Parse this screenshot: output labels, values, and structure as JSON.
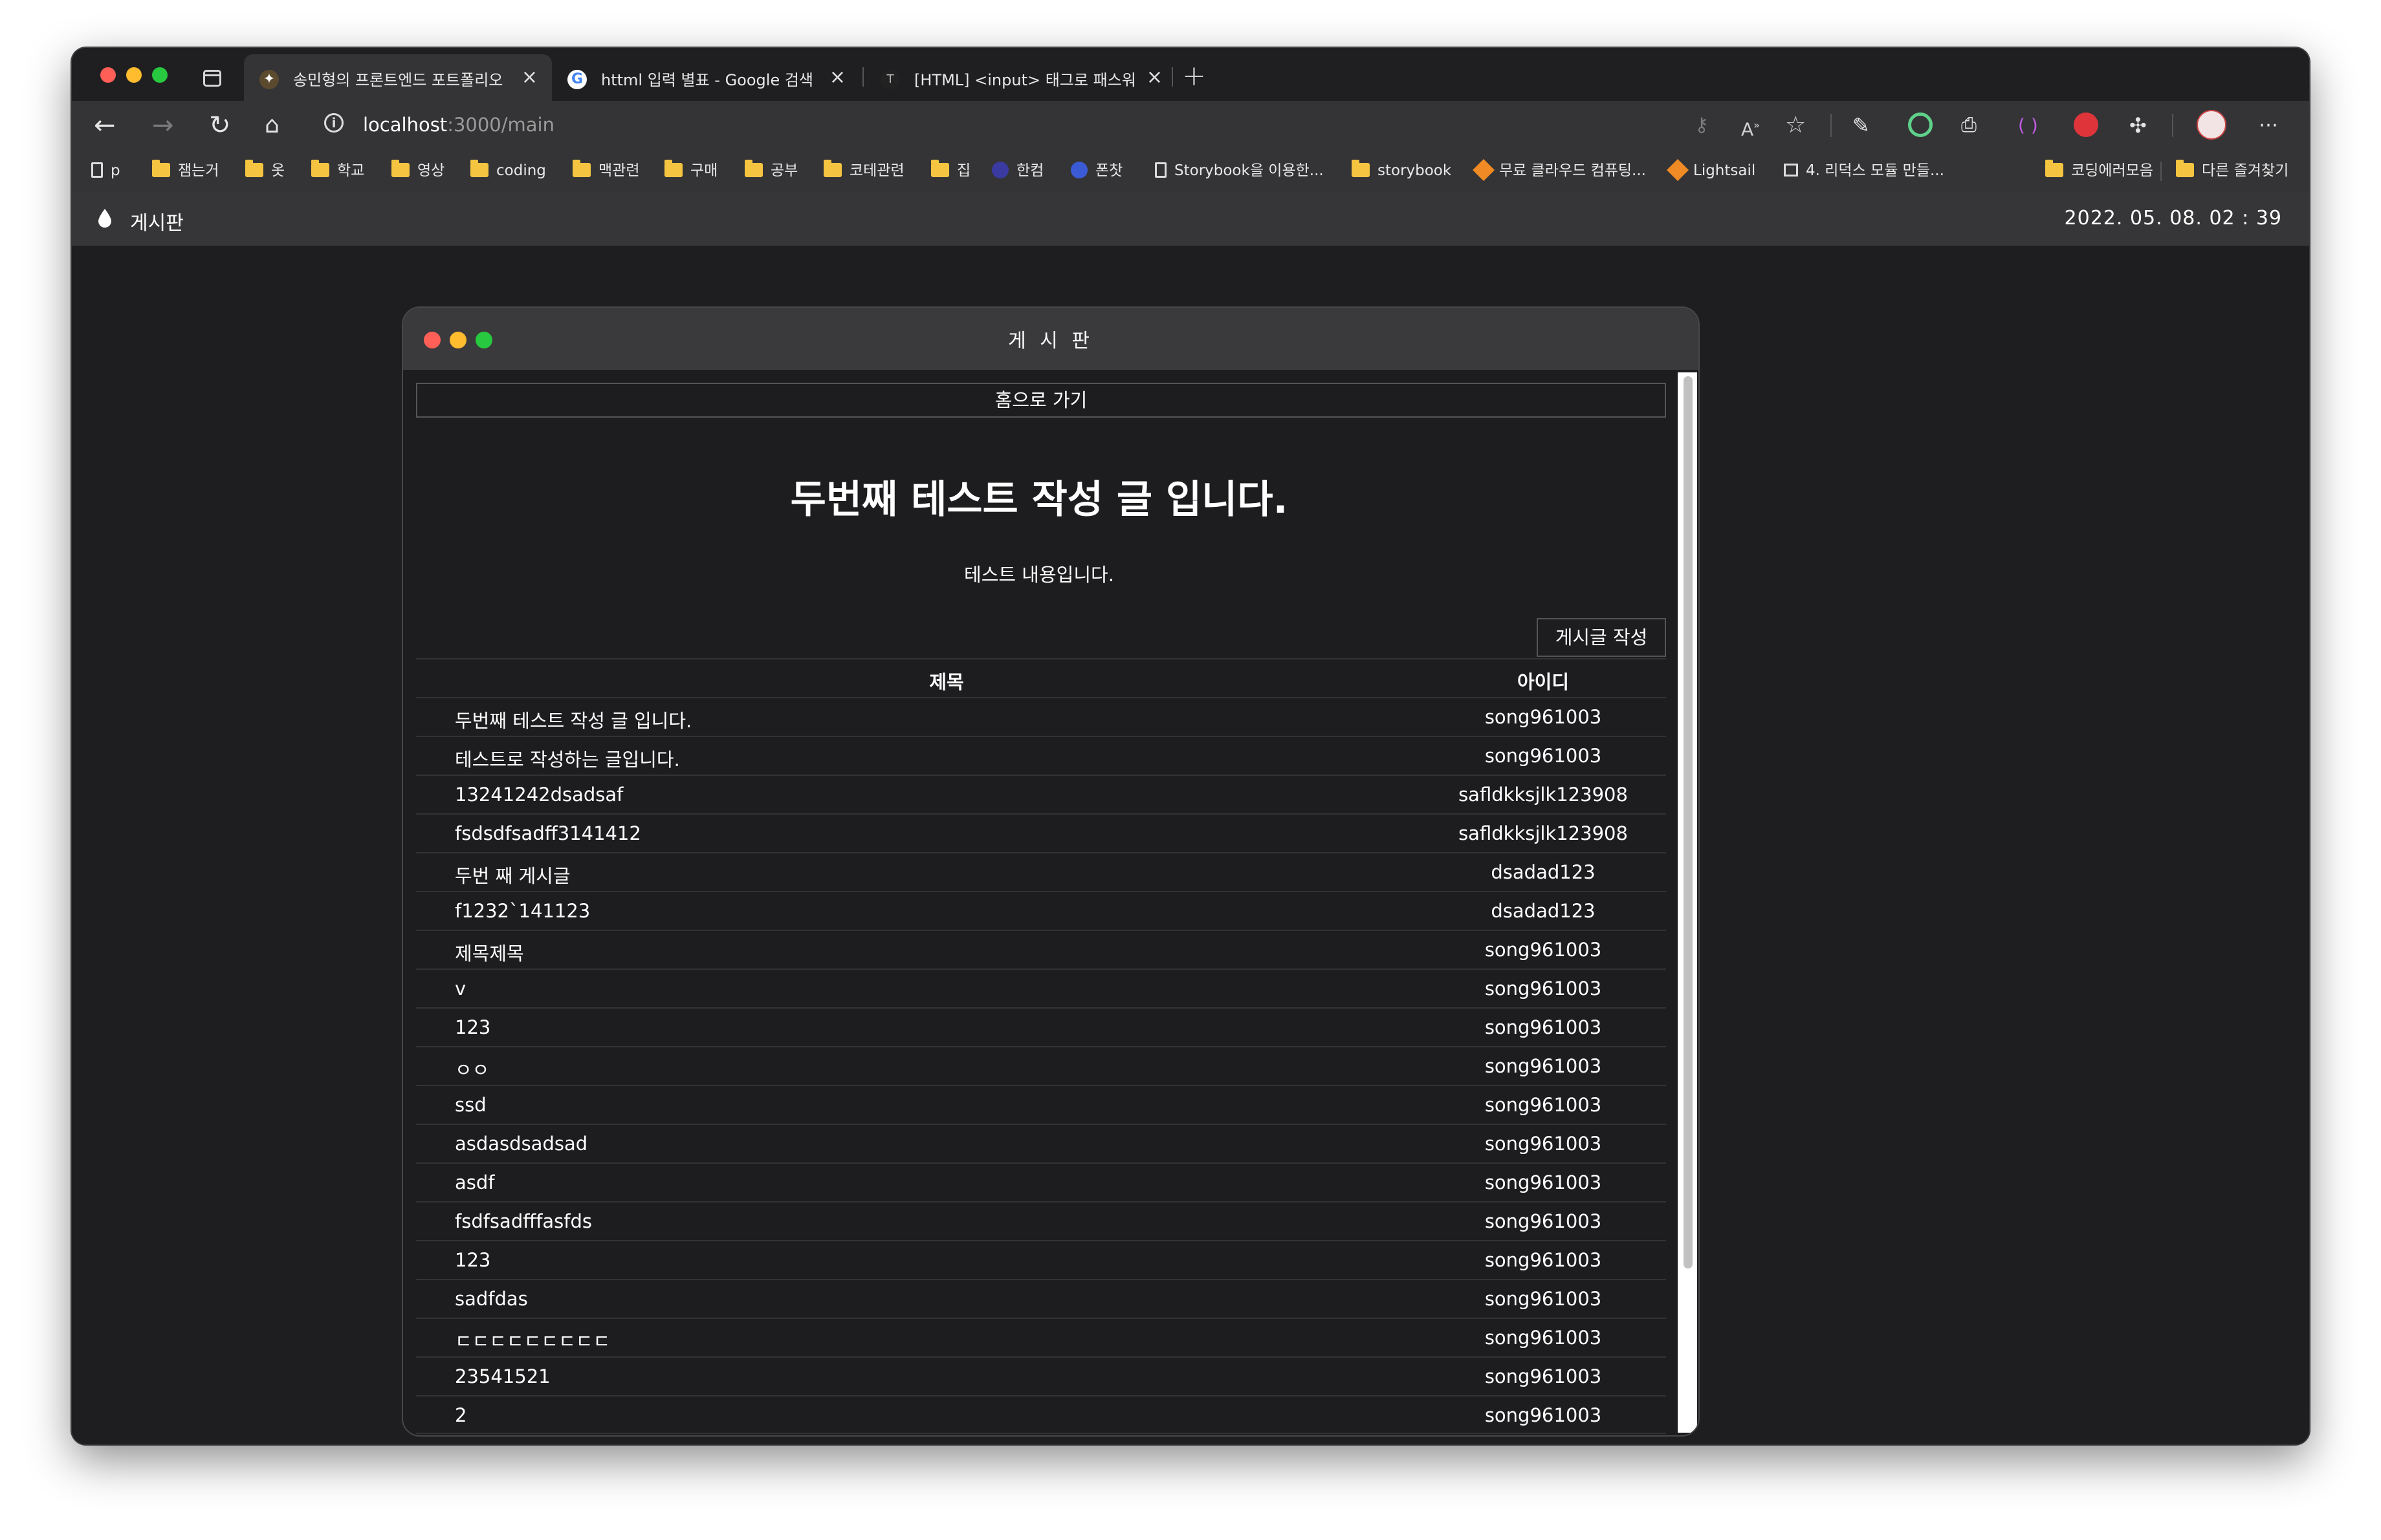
{
  "browser": {
    "tabs": [
      {
        "title": "송민형의 프론트엔드 포트폴리오",
        "active": true,
        "icon": "portfolio-favicon"
      },
      {
        "title": "httml 입력 별표 - Google 검색",
        "active": false,
        "icon": "google-favicon"
      },
      {
        "title": "[HTML] <input> 태그로 패스워드",
        "active": false,
        "icon": "tistory-favicon"
      }
    ],
    "url_host": "localhost",
    "url_path": ":3000/main",
    "bookmarks": [
      {
        "label": "p",
        "icon": "page-icon"
      },
      {
        "label": "잼는거",
        "icon": "folder-icon"
      },
      {
        "label": "옷",
        "icon": "folder-icon"
      },
      {
        "label": "학교",
        "icon": "folder-icon"
      },
      {
        "label": "영상",
        "icon": "folder-icon"
      },
      {
        "label": "coding",
        "icon": "folder-icon"
      },
      {
        "label": "맥관련",
        "icon": "folder-icon"
      },
      {
        "label": "구매",
        "icon": "folder-icon"
      },
      {
        "label": "공부",
        "icon": "folder-icon"
      },
      {
        "label": "코테관련",
        "icon": "folder-icon"
      },
      {
        "label": "집",
        "icon": "folder-icon"
      },
      {
        "label": "한컴",
        "icon": "hancom-icon"
      },
      {
        "label": "폰찻",
        "icon": "phone-icon"
      },
      {
        "label": "Storybook을 이용한...",
        "icon": "page-icon"
      },
      {
        "label": "storybook",
        "icon": "folder-icon"
      },
      {
        "label": "무료 클라우드 컴퓨팅...",
        "icon": "aws-icon"
      },
      {
        "label": "Lightsail",
        "icon": "aws-icon"
      },
      {
        "label": "4. 리덕스 모듈 만들...",
        "icon": "book-icon"
      },
      {
        "label": "코딩에러모음",
        "icon": "folder-icon"
      }
    ],
    "other_bookmarks": "다른 즐겨찾기"
  },
  "appbar": {
    "title": "게시판",
    "clock": "2022. 05. 08.   02 : 39"
  },
  "board": {
    "window_title": "게 시 판",
    "home_button": "홈으로 가기",
    "post_title": "두번째 테스트 작성 글 입니다.",
    "post_body": "테스트 내용입니다.",
    "write_button": "게시글 작성",
    "columns": {
      "title": "제목",
      "id": "아이디"
    },
    "rows": [
      {
        "title": "두번째 테스트 작성 글 입니다.",
        "id": "song961003"
      },
      {
        "title": "테스트로 작성하는 글입니다.",
        "id": "song961003"
      },
      {
        "title": "13241242dsadsaf",
        "id": "safldkksjlk123908"
      },
      {
        "title": "fsdsdfsadff3141412",
        "id": "safldkksjlk123908"
      },
      {
        "title": "두번 째 게시글",
        "id": "dsadad123"
      },
      {
        "title": "f1232`141123",
        "id": "dsadad123"
      },
      {
        "title": "제목제목",
        "id": "song961003"
      },
      {
        "title": "v",
        "id": "song961003"
      },
      {
        "title": "123",
        "id": "song961003"
      },
      {
        "title": "ㅇㅇ",
        "id": "song961003"
      },
      {
        "title": "ssd",
        "id": "song961003"
      },
      {
        "title": "asdasdsadsad",
        "id": "song961003"
      },
      {
        "title": "asdf",
        "id": "song961003"
      },
      {
        "title": "fsdfsadfffasfds",
        "id": "song961003"
      },
      {
        "title": "123",
        "id": "song961003"
      },
      {
        "title": "sadfdas",
        "id": "song961003"
      },
      {
        "title": "ㄷㄷㄷㄷㄷㄷㄷㄷㄷ",
        "id": "song961003"
      },
      {
        "title": "23541521",
        "id": "song961003"
      },
      {
        "title": "2",
        "id": "song961003"
      }
    ]
  },
  "colors": {
    "close": "#ff5f57",
    "minimize": "#febc2e",
    "zoom": "#28c840",
    "background": "#1e1d1f"
  }
}
